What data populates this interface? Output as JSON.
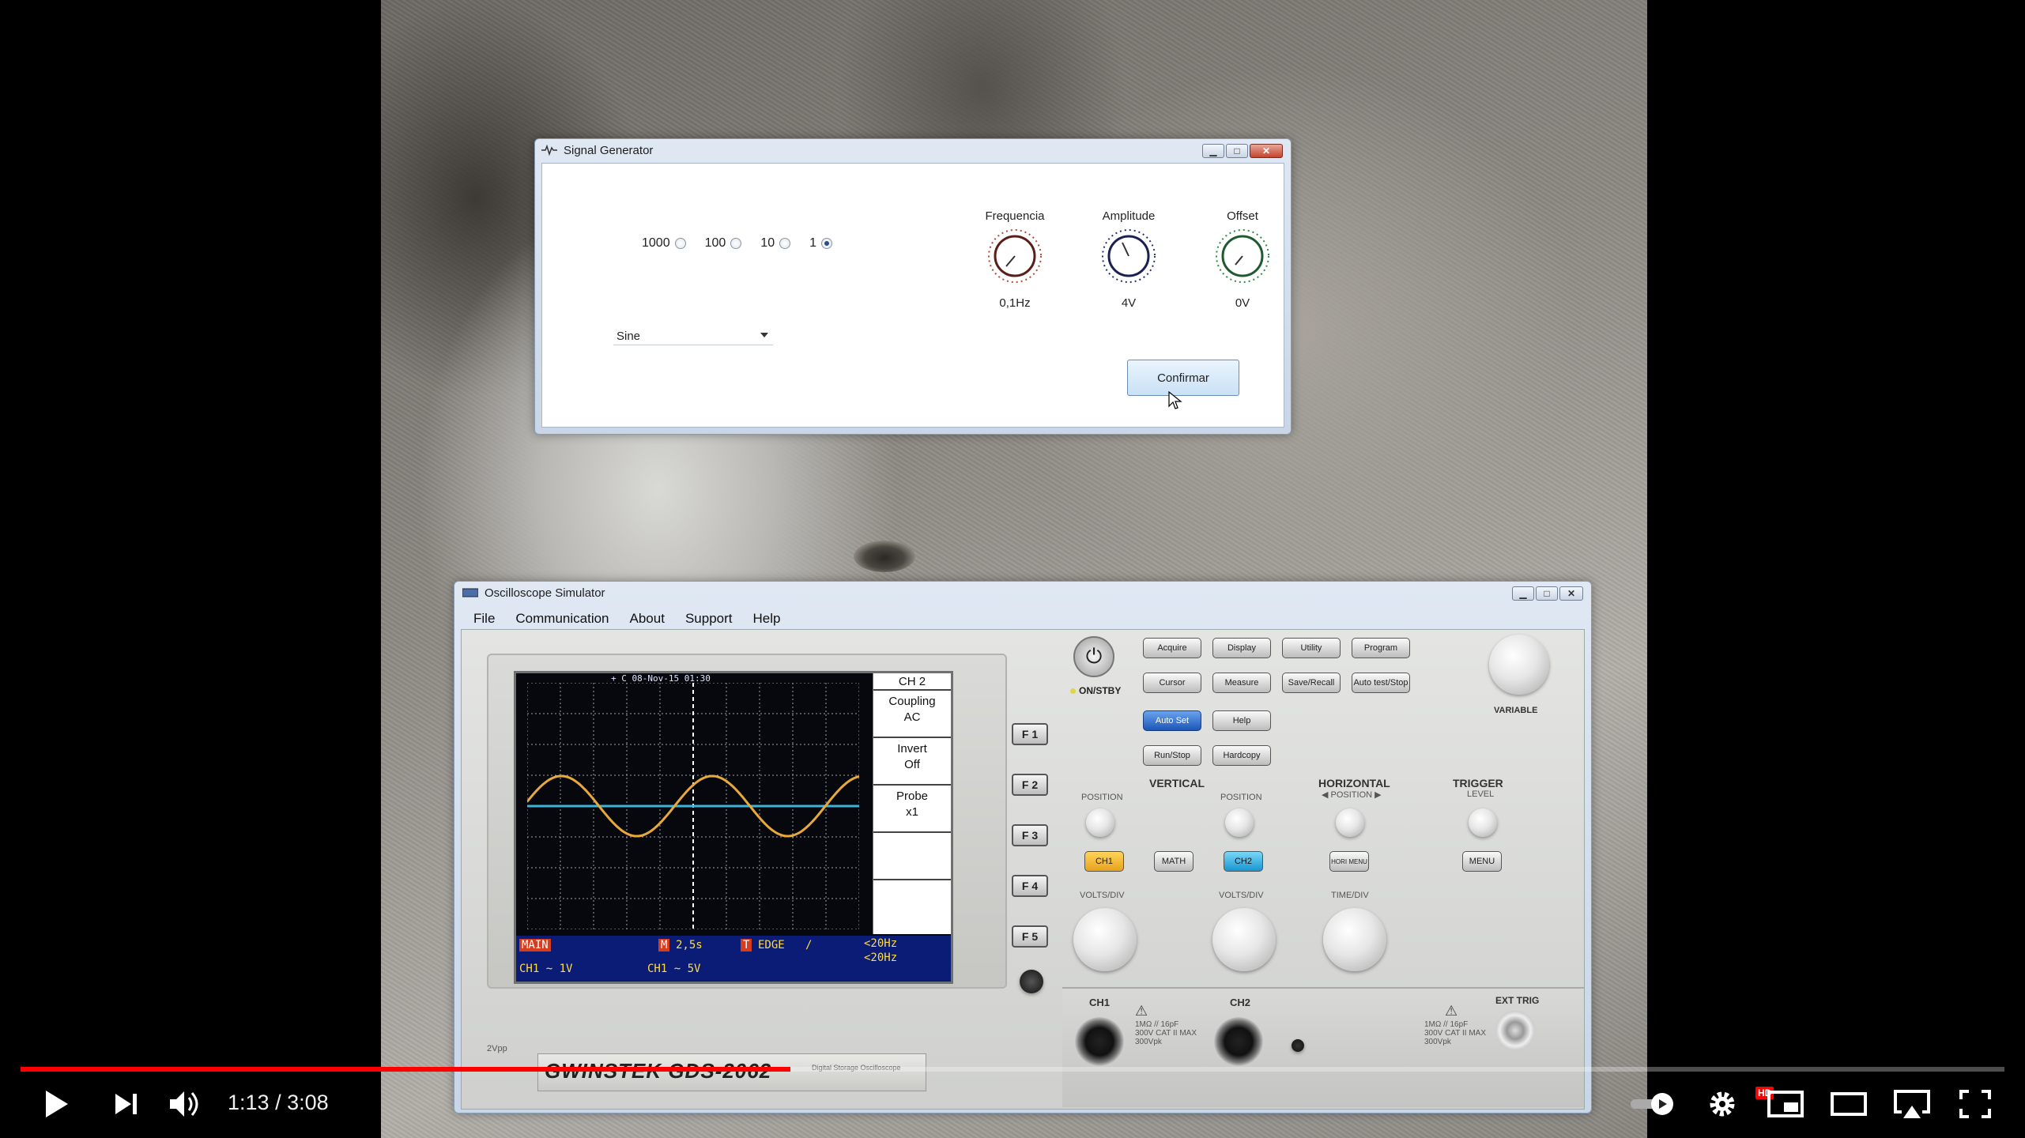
{
  "signal_generator": {
    "title": "Signal Generator",
    "multiplier_options": [
      {
        "label": "1000",
        "selected": false
      },
      {
        "label": "100",
        "selected": false
      },
      {
        "label": "10",
        "selected": false
      },
      {
        "label": "1",
        "selected": true
      }
    ],
    "waveform_selected": "Sine",
    "knobs": [
      {
        "label": "Frequencia",
        "value": "0,1Hz",
        "accent": "#b04a3a"
      },
      {
        "label": "Amplitude",
        "value": "4V",
        "accent": "#23306e"
      },
      {
        "label": "Offset",
        "value": "0V",
        "accent": "#2e8a48"
      }
    ],
    "confirm_label": "Confirmar"
  },
  "oscilloscope": {
    "title": "Oscilloscope Simulator",
    "menu": [
      "File",
      "Communication",
      "About",
      "Support",
      "Help"
    ],
    "screen": {
      "header": "+ C  08-Nov-15 01:30",
      "side_menu": {
        "channel": "CH 2",
        "coupling_label": "Coupling",
        "coupling_value": "AC",
        "invert_label": "Invert",
        "invert_value": "Off",
        "probe_label": "Probe",
        "probe_value": "x1"
      },
      "status": {
        "main_tag": "MAIN",
        "m_tag": "M",
        "timebase": "2,5s",
        "t_tag": "T",
        "trigger_mode": "EDGE",
        "trigger_slope": "/",
        "freq1": "<20Hz",
        "freq2": "<20Hz",
        "ch1": "CH1 ~ 1V",
        "ch2": "CH1 ~ 5V"
      },
      "trace_colors": {
        "ch1": "#e8a93a",
        "ch2": "#3cb5d8"
      }
    },
    "fkeys": [
      "F 1",
      "F 2",
      "F 3",
      "F 4",
      "F 5"
    ],
    "controls": {
      "on_stby": "ON/STBY",
      "buttons_row1": [
        "Acquire",
        "Display",
        "Utility",
        "Program"
      ],
      "buttons_row2": [
        "Cursor",
        "Measure",
        "Save/Recall",
        "Auto test/Stop"
      ],
      "autoset": "Auto Set",
      "help": "Help",
      "run_stop": "Run/Stop",
      "hardcopy": "Hardcopy",
      "variable": "VARIABLE",
      "vertical": "VERTICAL",
      "horizontal": "HORIZONTAL",
      "horizontal_sub": "◀ POSITION ▶",
      "trigger": "TRIGGER",
      "trigger_sub": "LEVEL",
      "position": "POSITION",
      "ch1": "CH1",
      "math": "MATH",
      "ch2": "CH2",
      "hori_menu": "HORI MENU",
      "menu": "MENU",
      "volts_div": "VOLTS/DIV",
      "time_div": "TIME/DIV",
      "ch1_input": "CH1",
      "ch2_input": "CH2",
      "input_spec": "1MΩ // 16pF 300V CAT II MAX 300Vpk",
      "ext_trig": "EXT TRIG",
      "ext_spec": "1MΩ // 16pF 300V CAT II MAX 300Vpk"
    },
    "brand": "GWINSTEK GDS-2062",
    "brand_sub": "Digital Storage Oscilloscope",
    "cal_label": "2Vpp"
  },
  "player": {
    "current_time": "1:13",
    "duration": "3:08",
    "progress": 0.388,
    "hd_badge": "HD"
  }
}
